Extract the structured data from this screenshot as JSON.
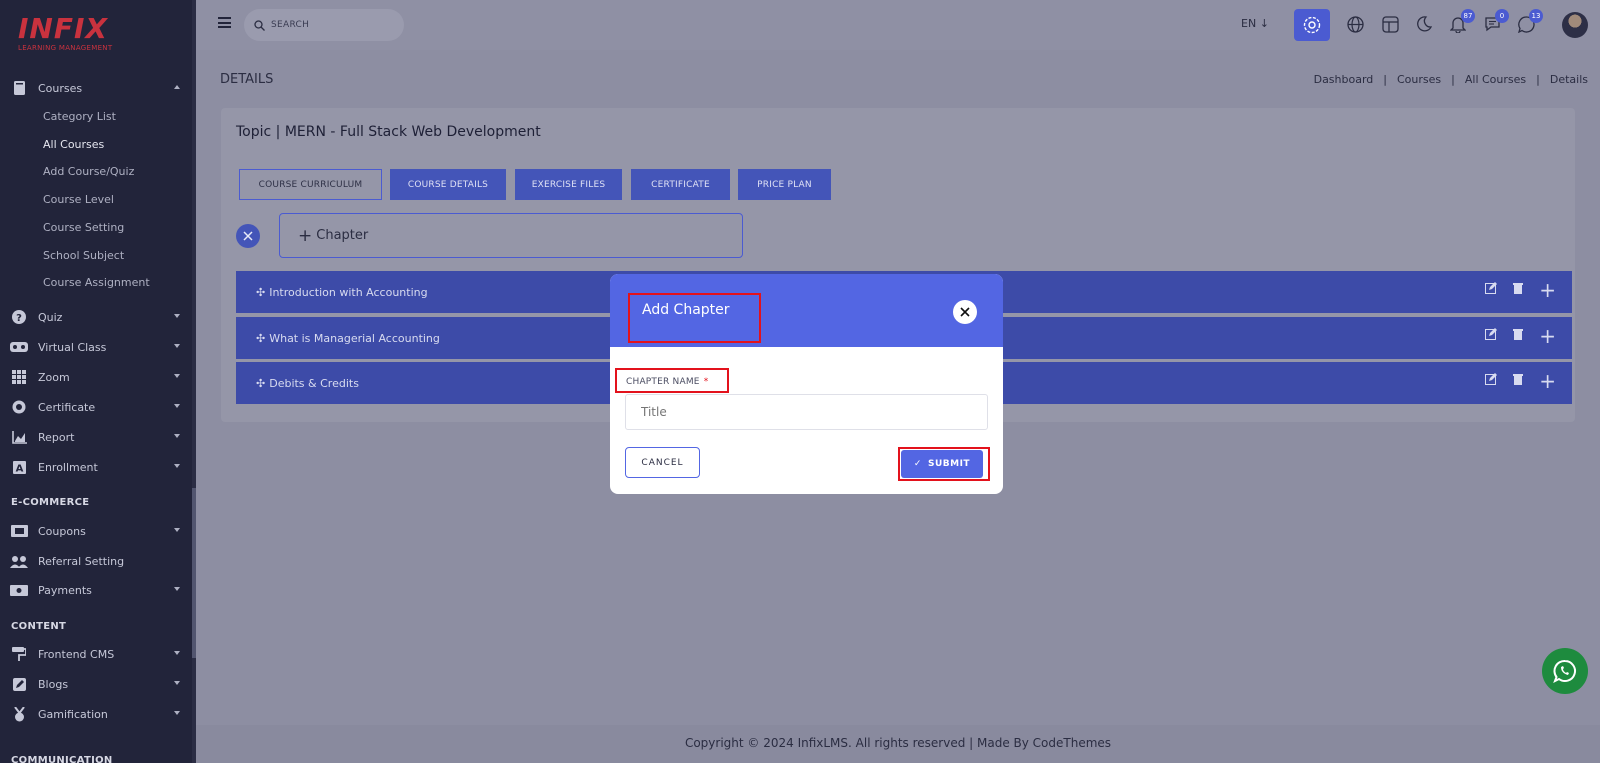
{
  "brand": {
    "logo_text": "INFIX",
    "logo_sub": "LEARNING MANAGEMENT"
  },
  "sidebar": {
    "courses": {
      "label": "Courses",
      "sub_items": [
        "Category List",
        "All Courses",
        "Add Course/Quiz",
        "Course Level",
        "Course Setting",
        "School Subject",
        "Course Assignment"
      ]
    },
    "items": [
      {
        "label": "Quiz",
        "icon": "question-circle-icon"
      },
      {
        "label": "Virtual Class",
        "icon": "vr-headset-icon"
      },
      {
        "label": "Zoom",
        "icon": "grid-icon"
      },
      {
        "label": "Certificate",
        "icon": "certificate-icon"
      },
      {
        "label": "Report",
        "icon": "chart-icon"
      },
      {
        "label": "Enrollment",
        "icon": "enrollment-icon"
      }
    ],
    "ecommerce_label": "E-COMMERCE",
    "ecommerce_items": [
      {
        "label": "Coupons",
        "icon": "coupon-icon"
      },
      {
        "label": "Referral Setting",
        "icon": "users-icon"
      },
      {
        "label": "Payments",
        "icon": "money-icon"
      }
    ],
    "content_label": "CONTENT",
    "content_items": [
      {
        "label": "Frontend CMS",
        "icon": "paint-roller-icon"
      },
      {
        "label": "Blogs",
        "icon": "edit-icon"
      },
      {
        "label": "Gamification",
        "icon": "medal-icon"
      }
    ],
    "communication_label": "COMMUNICATION"
  },
  "topbar": {
    "search_placeholder": "SEARCH",
    "lang": "EN",
    "badges": {
      "notifications": "87",
      "messages": "0",
      "chat": "13"
    }
  },
  "page": {
    "title": "DETAILS",
    "breadcrumb": [
      "Dashboard",
      "|",
      "Courses",
      "|",
      "All Courses",
      "|",
      "Details"
    ]
  },
  "card": {
    "title": "Topic | MERN - Full Stack Web Development",
    "tabs": [
      "COURSE CURRICULUM",
      "COURSE DETAILS",
      "EXERCISE FILES",
      "CERTIFICATE",
      "PRICE PLAN"
    ],
    "chapter_button": "Chapter",
    "chapters": [
      "Introduction with Accounting",
      "What is Managerial Accounting",
      "Debits & Credits"
    ]
  },
  "modal": {
    "title": "Add Chapter",
    "field_label": "CHAPTER NAME",
    "required_mark": "*",
    "field_placeholder": "Title",
    "cancel_label": "CANCEL",
    "submit_label": "SUBMIT"
  },
  "footer": {
    "text": "Copyright © 2024 InfixLMS. All rights reserved | Made By CodeThemes"
  },
  "colors": {
    "primary": "#5366e3",
    "sidebar": "#22243a",
    "highlight": "#e3121c",
    "whatsapp": "#1e8b3e"
  }
}
